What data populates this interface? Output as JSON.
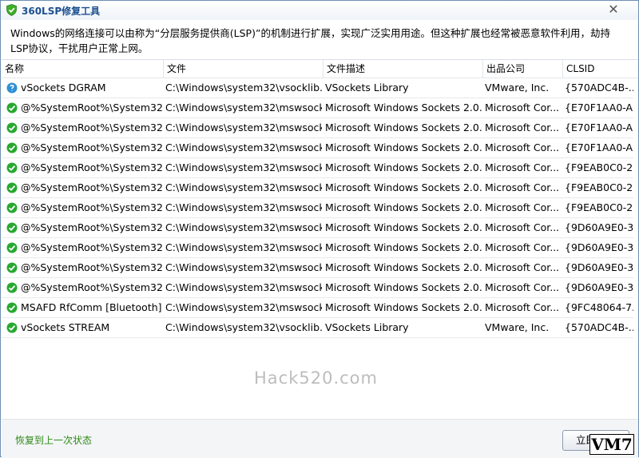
{
  "window": {
    "title": "360LSP修复工具",
    "close_symbol": "✕"
  },
  "description": "Windows的网络连接可以由称为“分层服务提供商(LSP)”的机制进行扩展，实现广泛实用用途。但这种扩展也经常被恶意软件利用，劫持LSP协议，干扰用户正常上网。",
  "table": {
    "columns": [
      "名称",
      "文件",
      "文件描述",
      "出品公司",
      "CLSID"
    ],
    "rows": [
      {
        "icon": "info",
        "name": "vSockets DGRAM",
        "file": "C:\\Windows\\system32\\vsocklib....",
        "desc": "VSockets Library",
        "company": "VMware, Inc.",
        "clsid": "{570ADC4B-..."
      },
      {
        "icon": "ok",
        "name": "@%SystemRoot%\\System32...",
        "file": "C:\\Windows\\system32\\mswsock....",
        "desc": "Microsoft Windows Sockets 2.0...",
        "company": "Microsoft Cor...",
        "clsid": "{E70F1AA0-A..."
      },
      {
        "icon": "ok",
        "name": "@%SystemRoot%\\System32...",
        "file": "C:\\Windows\\system32\\mswsock....",
        "desc": "Microsoft Windows Sockets 2.0...",
        "company": "Microsoft Cor...",
        "clsid": "{E70F1AA0-A..."
      },
      {
        "icon": "ok",
        "name": "@%SystemRoot%\\System32...",
        "file": "C:\\Windows\\system32\\mswsock....",
        "desc": "Microsoft Windows Sockets 2.0...",
        "company": "Microsoft Cor...",
        "clsid": "{E70F1AA0-A..."
      },
      {
        "icon": "ok",
        "name": "@%SystemRoot%\\System32...",
        "file": "C:\\Windows\\system32\\mswsock....",
        "desc": "Microsoft Windows Sockets 2.0...",
        "company": "Microsoft Cor...",
        "clsid": "{F9EAB0C0-2..."
      },
      {
        "icon": "ok",
        "name": "@%SystemRoot%\\System32...",
        "file": "C:\\Windows\\system32\\mswsock....",
        "desc": "Microsoft Windows Sockets 2.0...",
        "company": "Microsoft Cor...",
        "clsid": "{F9EAB0C0-2..."
      },
      {
        "icon": "ok",
        "name": "@%SystemRoot%\\System32...",
        "file": "C:\\Windows\\system32\\mswsock....",
        "desc": "Microsoft Windows Sockets 2.0...",
        "company": "Microsoft Cor...",
        "clsid": "{F9EAB0C0-2..."
      },
      {
        "icon": "ok",
        "name": "@%SystemRoot%\\System32...",
        "file": "C:\\Windows\\system32\\mswsock....",
        "desc": "Microsoft Windows Sockets 2.0...",
        "company": "Microsoft Cor...",
        "clsid": "{9D60A9E0-3..."
      },
      {
        "icon": "ok",
        "name": "@%SystemRoot%\\System32...",
        "file": "C:\\Windows\\system32\\mswsock....",
        "desc": "Microsoft Windows Sockets 2.0...",
        "company": "Microsoft Cor...",
        "clsid": "{9D60A9E0-3..."
      },
      {
        "icon": "ok",
        "name": "@%SystemRoot%\\System32...",
        "file": "C:\\Windows\\system32\\mswsock....",
        "desc": "Microsoft Windows Sockets 2.0...",
        "company": "Microsoft Cor...",
        "clsid": "{9D60A9E0-3..."
      },
      {
        "icon": "ok",
        "name": "@%SystemRoot%\\System32...",
        "file": "C:\\Windows\\system32\\mswsock....",
        "desc": "Microsoft Windows Sockets 2.0...",
        "company": "Microsoft Cor...",
        "clsid": "{9D60A9E0-3..."
      },
      {
        "icon": "ok",
        "name": "MSAFD RfComm [Bluetooth]",
        "file": "C:\\Windows\\system32\\mswsock....",
        "desc": "Microsoft Windows Sockets 2.0...",
        "company": "Microsoft Cor...",
        "clsid": "{9FC48064-7..."
      },
      {
        "icon": "ok",
        "name": "vSockets STREAM",
        "file": "C:\\Windows\\system32\\vsocklib....",
        "desc": "VSockets Library",
        "company": "VMware, Inc.",
        "clsid": "{570ADC4B-..."
      }
    ]
  },
  "watermark": "Hack520.com",
  "footer": {
    "restore_label": "恢复到上一次状态",
    "fix_label": "立即修复"
  },
  "badge": "VM7",
  "colors": {
    "ok_icon": "#27a830",
    "info_icon": "#2e8fd6",
    "link": "#2f8a17",
    "title": "#1d4f91"
  }
}
